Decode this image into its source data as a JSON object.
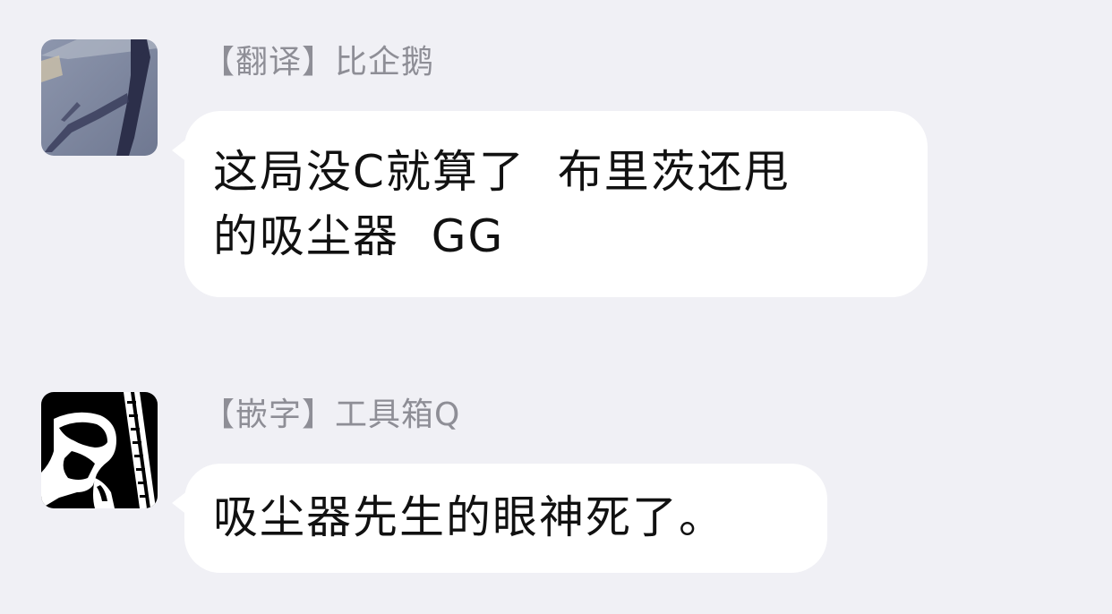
{
  "messages": [
    {
      "sender": "【翻译】比企鹅",
      "text": "这局没C就算了  布里茨还甩\n的吸尘器  GG",
      "avatar_icon": "shadow-walking-photo-avatar"
    },
    {
      "sender": "【嵌字】工具箱Q",
      "text": "吸尘器先生的眼神死了。",
      "avatar_icon": "silhouette-portrait-avatar"
    }
  ],
  "colors": {
    "background": "#f0f0f5",
    "bubble": "#ffffff",
    "sender_text": "#8e8e96",
    "message_text": "#111111"
  }
}
